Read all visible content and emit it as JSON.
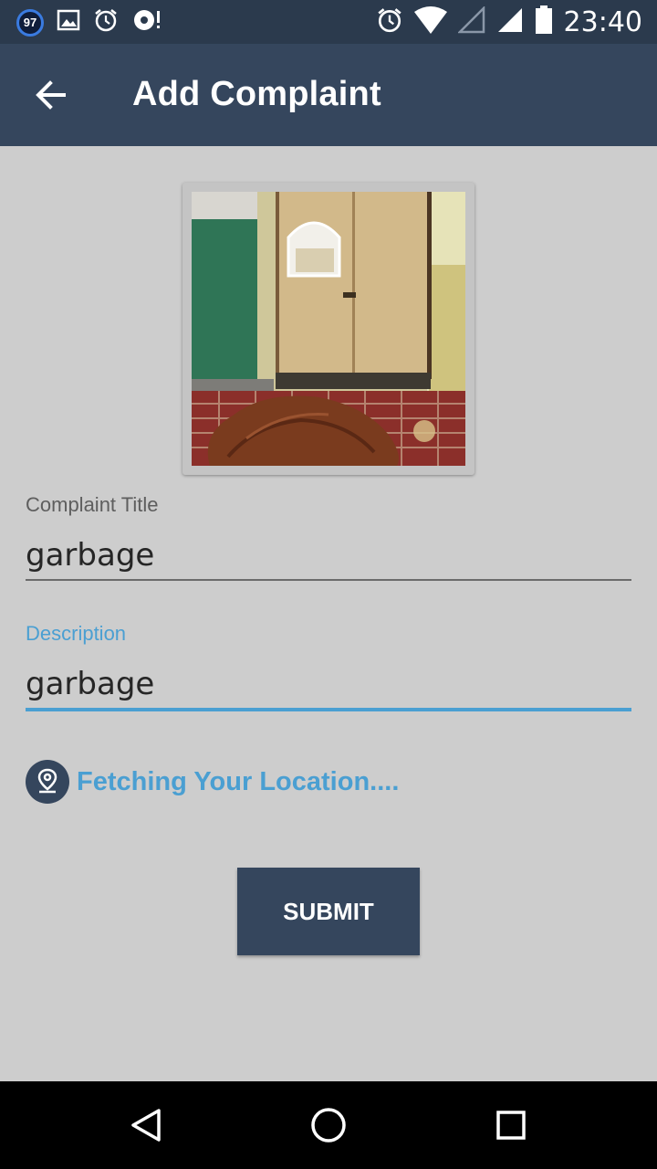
{
  "status_bar": {
    "badge_count": "97",
    "time": "23:40",
    "icons": [
      "notification-badge",
      "image-icon",
      "alarm-icon",
      "sync-icon",
      "alarm-icon",
      "wifi-icon",
      "signal-empty-icon",
      "signal-full-icon",
      "battery-icon"
    ]
  },
  "app_bar": {
    "title": "Add Complaint",
    "back_icon": "arrow-back-icon"
  },
  "form": {
    "photo_alt": "complaint-photo",
    "title_label": "Complaint Title",
    "title_value": "garbage",
    "description_label": "Description",
    "description_value": "garbage",
    "location_text": "Fetching Your Location....",
    "submit_label": "SUBMIT"
  },
  "colors": {
    "primary": "#35465d",
    "accent": "#4a9fd2",
    "background": "#cdcdcd"
  },
  "nav_bar": {
    "icons": [
      "back-triangle-icon",
      "home-circle-icon",
      "recents-square-icon"
    ]
  }
}
